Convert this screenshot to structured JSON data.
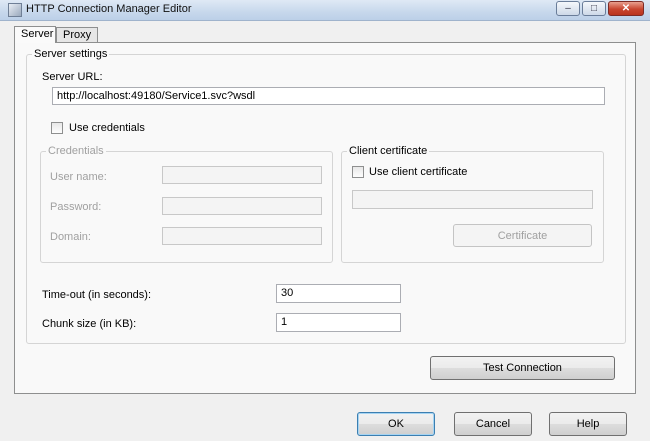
{
  "window": {
    "title": "HTTP Connection Manager Editor",
    "icon": "app-icon",
    "controls": {
      "minimize": "–",
      "maximize": "□",
      "close": "✕"
    }
  },
  "tabs": [
    {
      "label": "Server",
      "selected": true
    },
    {
      "label": "Proxy",
      "selected": false
    }
  ],
  "server_settings": {
    "legend": "Server settings",
    "server_url_label": "Server URL:",
    "server_url_value": "http://localhost:49180/Service1.svc?wsdl",
    "use_credentials_label": "Use credentials",
    "use_credentials_checked": false,
    "credentials": {
      "legend": "Credentials",
      "user_name_label": "User name:",
      "password_label": "Password:",
      "domain_label": "Domain:",
      "user_name_value": "",
      "password_value": "",
      "domain_value": ""
    },
    "client_certificate": {
      "legend": "Client certificate",
      "use_client_certificate_label": "Use client certificate",
      "use_client_certificate_checked": false,
      "certificate_value": "",
      "certificate_button": "Certificate"
    },
    "timeout_label": "Time-out (in seconds):",
    "timeout_value": "30",
    "chunk_size_label": "Chunk size (in KB):",
    "chunk_size_value": "1"
  },
  "buttons": {
    "test_connection": "Test Connection",
    "ok": "OK",
    "cancel": "Cancel",
    "help": "Help"
  }
}
